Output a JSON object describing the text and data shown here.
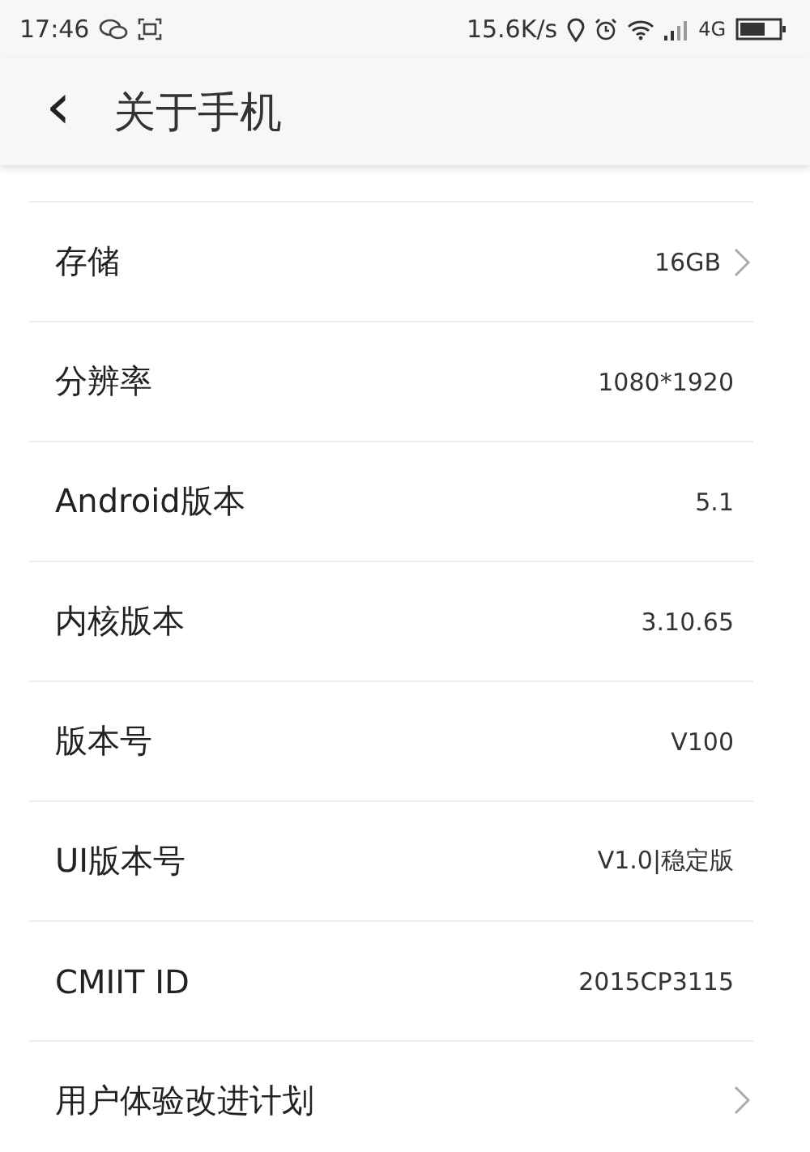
{
  "status_bar": {
    "time": "17:46",
    "speed": "15.6K/s",
    "network": "4G"
  },
  "header": {
    "back": "‹",
    "title": "关于手机"
  },
  "rows": [
    {
      "label": "存储",
      "value": "16GB",
      "chevron": true,
      "kind": "full"
    },
    {
      "label": "分辨率",
      "value": "1080*1920",
      "chevron": false,
      "kind": "full"
    },
    {
      "label": "Android版本",
      "value": "5.1",
      "chevron": false,
      "kind": "full"
    },
    {
      "label": "内核版本",
      "value": "3.10.65",
      "chevron": false,
      "kind": "full"
    },
    {
      "label": "版本号",
      "value": "V100",
      "chevron": false,
      "kind": "full"
    },
    {
      "label": "UI版本号",
      "value": "V1.0|稳定版",
      "chevron": false,
      "kind": "full"
    },
    {
      "label": "CMIIT ID",
      "value": "2015CP3115",
      "chevron": false,
      "kind": "full"
    },
    {
      "label": "用户体验改进计划",
      "chevron": true,
      "kind": "last"
    }
  ]
}
